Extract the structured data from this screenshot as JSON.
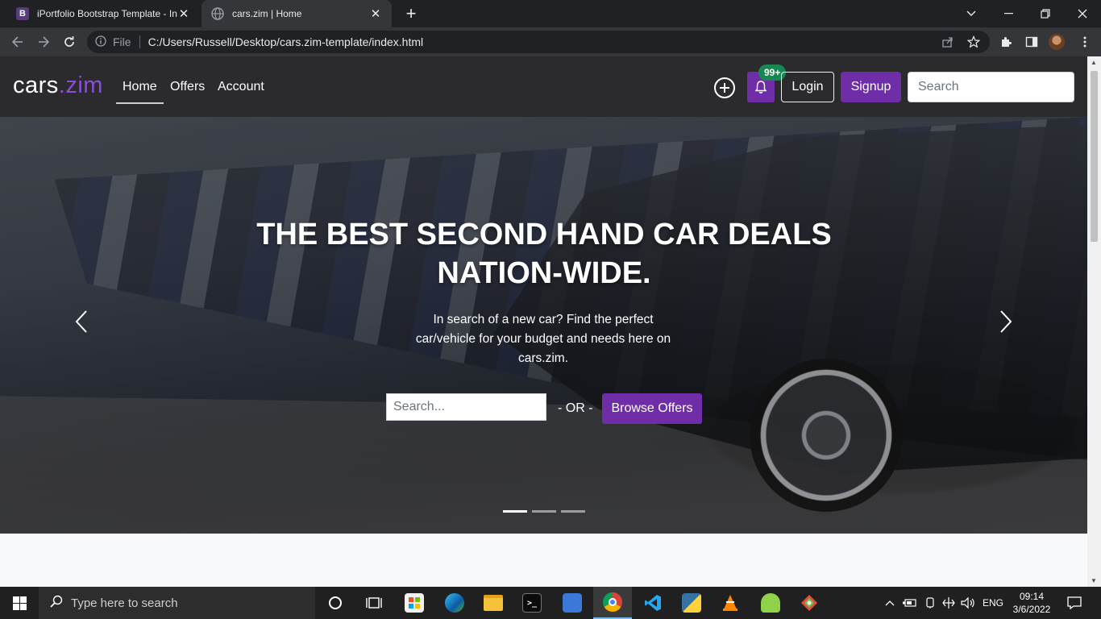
{
  "browser": {
    "tabs": [
      {
        "title": "iPortfolio Bootstrap Template - In",
        "favicon": "bootstrap-icon",
        "favicon_letter": "B"
      },
      {
        "title": "cars.zim | Home",
        "favicon": "globe-icon"
      }
    ],
    "address": {
      "scheme_label": "File",
      "url": "C:/Users/Russell/Desktop/cars.zim-template/index.html"
    }
  },
  "site": {
    "brand": {
      "main": "cars",
      "accent": ".zim"
    },
    "nav": [
      {
        "label": "Home",
        "active": true
      },
      {
        "label": "Offers"
      },
      {
        "label": "Account"
      }
    ],
    "notification_count": "99+",
    "login_label": "Login",
    "signup_label": "Signup",
    "search_placeholder": "Search",
    "colors": {
      "brand_purple": "#6f2da8",
      "badge_green": "#198754",
      "navbar_bg": "#2b2b2e"
    }
  },
  "hero": {
    "title": "THE BEST SECOND HAND CAR DEALS NATION-WIDE.",
    "subtitle": "In search of a new car? Find the perfect car/vehicle for your budget and needs here on cars.zim.",
    "search_placeholder": "Search...",
    "or_text": "- OR -",
    "browse_label": "Browse Offers",
    "slides": 3,
    "active_slide": 1
  },
  "taskbar": {
    "search_placeholder": "Type here to search",
    "language": "ENG",
    "time": "09:14",
    "date": "3/6/2022"
  }
}
